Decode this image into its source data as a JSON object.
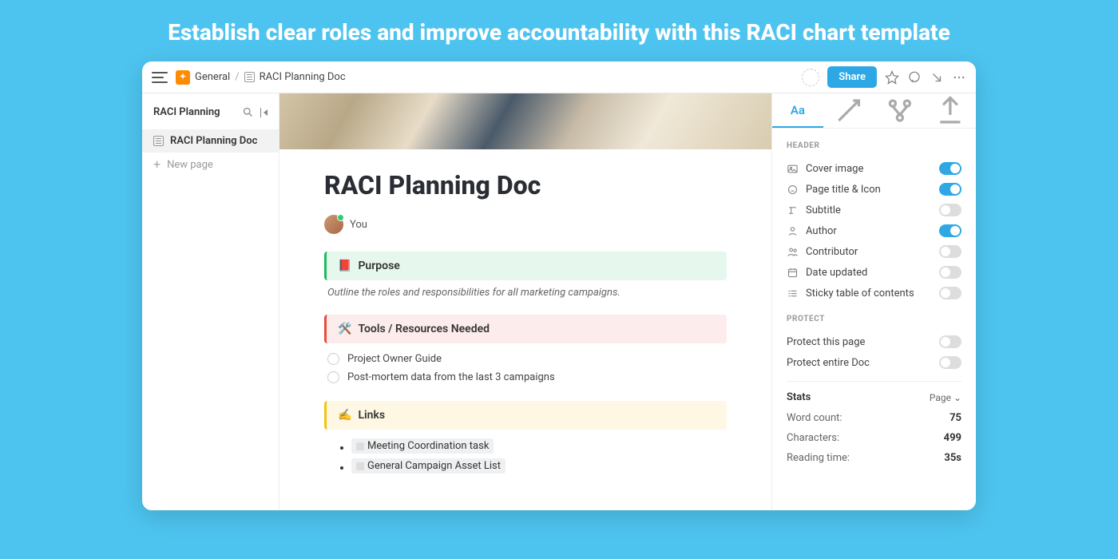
{
  "hero": {
    "title": "Establish clear roles and improve accountability with this RACI chart template"
  },
  "breadcrumb": {
    "workspace": "General",
    "doc": "RACI Planning Doc"
  },
  "topbar": {
    "share": "Share"
  },
  "sidebar": {
    "title": "RACI Planning",
    "items": [
      {
        "label": "RACI Planning Doc"
      },
      {
        "label": "New page"
      }
    ]
  },
  "doc": {
    "title": "RACI Planning Doc",
    "author": "You",
    "purpose": {
      "heading": "Purpose",
      "desc": "Outline the roles and responsibilities for all marketing campaigns."
    },
    "tools": {
      "heading": "Tools / Resources Needed",
      "items": [
        "Project Owner Guide",
        "Post-mortem data from the last 3 campaigns"
      ]
    },
    "links": {
      "heading": "Links",
      "items": [
        "Meeting Coordination task",
        "General Campaign Asset List"
      ]
    }
  },
  "rpanel": {
    "header_label": "HEADER",
    "opts": [
      {
        "label": "Cover image",
        "on": true
      },
      {
        "label": "Page title & Icon",
        "on": true
      },
      {
        "label": "Subtitle",
        "on": false
      },
      {
        "label": "Author",
        "on": true
      },
      {
        "label": "Contributor",
        "on": false
      },
      {
        "label": "Date updated",
        "on": false
      },
      {
        "label": "Sticky table of contents",
        "on": false
      }
    ],
    "protect_label": "PROTECT",
    "protect": [
      {
        "label": "Protect this page",
        "on": false
      },
      {
        "label": "Protect entire Doc",
        "on": false
      }
    ],
    "stats_label": "Stats",
    "stats_scope": "Page",
    "stats": [
      {
        "k": "Word count:",
        "v": "75"
      },
      {
        "k": "Characters:",
        "v": "499"
      },
      {
        "k": "Reading time:",
        "v": "35s"
      }
    ]
  }
}
